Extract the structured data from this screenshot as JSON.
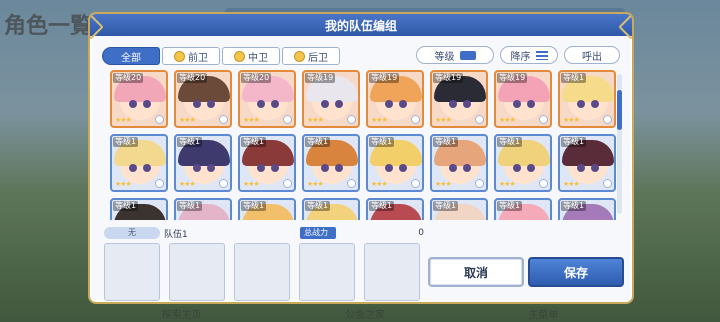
{
  "background": {
    "title": "角色一覧",
    "bottom_nav": [
      "探索主页",
      "",
      "",
      "",
      "公会之家",
      "",
      "主菜单"
    ]
  },
  "dialog": {
    "title": "我的队伍编组",
    "filters": [
      {
        "label": "全部",
        "active": true
      },
      {
        "label": "前卫",
        "active": false
      },
      {
        "label": "中卫",
        "active": false
      },
      {
        "label": "后卫",
        "active": false
      }
    ],
    "sort_label": "等级",
    "order_label": "降序",
    "call_label": "呼出",
    "team_no": "无",
    "team_name": "队伍1",
    "power_label": "总战力",
    "power_value": "0",
    "cancel_label": "取消",
    "save_label": "保存"
  },
  "characters": [
    {
      "level": "等级20",
      "hair": "#f2a7b8"
    },
    {
      "level": "等级20",
      "hair": "#6b4a3a"
    },
    {
      "level": "等级20",
      "hair": "#f4b6c9"
    },
    {
      "level": "等级19",
      "hair": "#e9e6ee"
    },
    {
      "level": "等级19",
      "hair": "#f0a45a"
    },
    {
      "level": "等级19",
      "hair": "#2b2b35"
    },
    {
      "level": "等级19",
      "hair": "#f4a3b6"
    },
    {
      "level": "等级1",
      "hair": "#f6dc8a"
    },
    {
      "level": "等级1",
      "hair": "#f3d98f"
    },
    {
      "level": "等级1",
      "hair": "#3f3a6e"
    },
    {
      "level": "等级1",
      "hair": "#8b3a3a"
    },
    {
      "level": "等级1",
      "hair": "#d8843e"
    },
    {
      "level": "等级1",
      "hair": "#f3cf6a"
    },
    {
      "level": "等级1",
      "hair": "#e6a57a"
    },
    {
      "level": "等级1",
      "hair": "#f0d17c"
    },
    {
      "level": "等级1",
      "hair": "#5a2c3a"
    },
    {
      "level": "等级1",
      "hair": "#3a3330"
    },
    {
      "level": "等级1",
      "hair": "#e4b4c8"
    },
    {
      "level": "等级1",
      "hair": "#f2c06a"
    },
    {
      "level": "等级1",
      "hair": "#f2d27c"
    },
    {
      "level": "等级1",
      "hair": "#b84a52"
    },
    {
      "level": "等级1",
      "hair": "#f1d6c6"
    },
    {
      "level": "等级1",
      "hair": "#f4aab8"
    },
    {
      "level": "等级1",
      "hair": "#a57ab8"
    }
  ],
  "team_slots": 5
}
